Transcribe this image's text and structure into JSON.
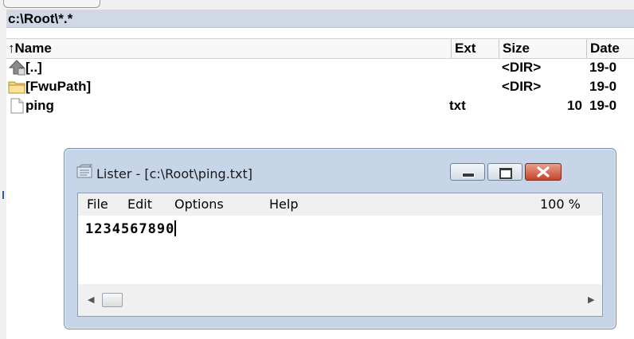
{
  "panel": {
    "path": "c:\\Root\\*.*",
    "columns": [
      {
        "label": "↑Name"
      },
      {
        "label": "Ext"
      },
      {
        "label": "Size"
      },
      {
        "label": "Date"
      }
    ],
    "rows": [
      {
        "icon": "up-folder-icon",
        "name": "[..]",
        "ext": "",
        "size": "<DIR>",
        "date": "19-0"
      },
      {
        "icon": "folder-icon",
        "name": "[FwuPath]",
        "ext": "",
        "size": "<DIR>",
        "date": "19-0"
      },
      {
        "icon": "text-file-icon",
        "name": "ping",
        "ext": "txt",
        "size": "10",
        "date": "19-0"
      }
    ]
  },
  "lister": {
    "title": "Lister - [c:\\Root\\ping.txt]",
    "menu": [
      "File",
      "Edit",
      "Options",
      "Help"
    ],
    "zoom": "100 %",
    "content": "1234567890",
    "close_color": "#c7442b"
  }
}
